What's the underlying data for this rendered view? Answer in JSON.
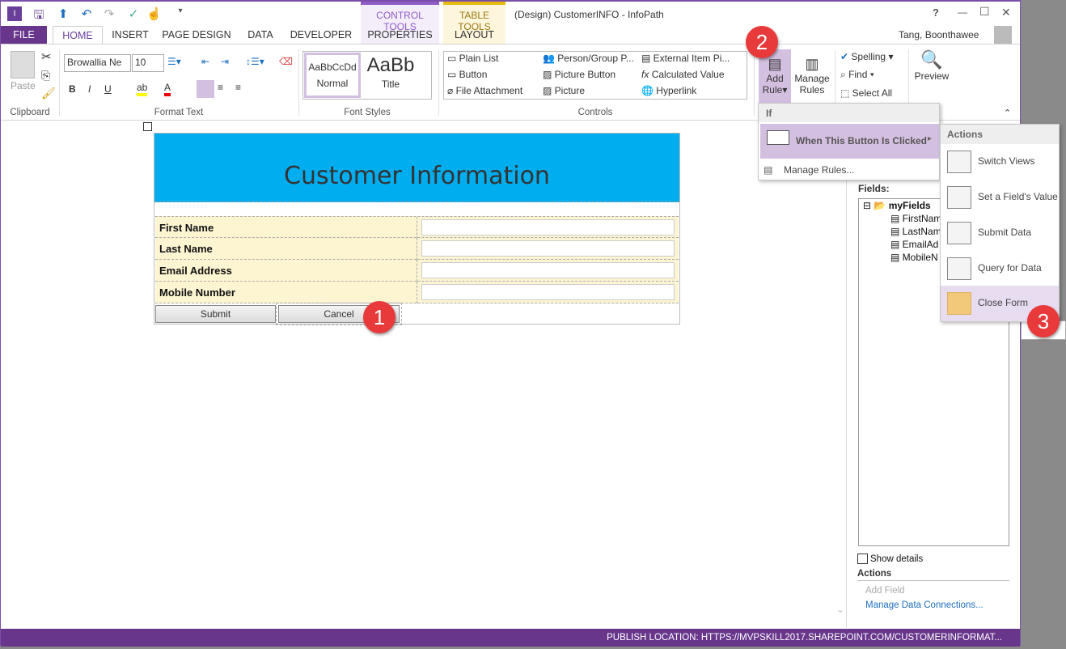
{
  "window": {
    "title": "(Design) CustomerINFO - InfoPath",
    "help": "?",
    "minimize": "—",
    "maximize": "☐",
    "close": "✕",
    "user": "Tang, Boonthawee"
  },
  "context_tabs": {
    "control_tools": "CONTROL TOOLS",
    "table_tools": "TABLE TOOLS"
  },
  "tabs": [
    "FILE",
    "HOME",
    "INSERT",
    "PAGE DESIGN",
    "DATA",
    "DEVELOPER",
    "PROPERTIES",
    "LAYOUT"
  ],
  "ribbon": {
    "clipboard": {
      "paste": "Paste",
      "group": "Clipboard"
    },
    "format_text": {
      "font": "Browallia Ne",
      "size": "10",
      "bold": "B",
      "italic": "I",
      "underline": "U",
      "group": "Format Text"
    },
    "font_styles": {
      "normal_preview": "AaBbCcDd",
      "normal": "Normal",
      "title_preview": "AaBb",
      "title": "Title",
      "group": "Font Styles"
    },
    "controls": {
      "items": [
        "Plain List",
        "Person/Group P...",
        "External Item Pi...",
        "Button",
        "Picture Button",
        "Calculated Value",
        "File Attachment",
        "Picture",
        "Hyperlink"
      ],
      "group": "Controls"
    },
    "add_rule": {
      "line1": "Add",
      "line2": "Rule"
    },
    "manage_rules": {
      "line1": "Manage",
      "line2": "Rules"
    },
    "editing": {
      "spelling": "Spelling",
      "find": "Find",
      "select_all": "Select All"
    },
    "preview": "Preview"
  },
  "add_rule_menu": {
    "header": "If",
    "item": "When This Button Is Clicked",
    "manage": "Manage Rules..."
  },
  "actions_menu": {
    "header": "Actions",
    "items": [
      "Switch Views",
      "Set a Field's Value",
      "Submit Data",
      "Query for Data",
      "Close Form"
    ]
  },
  "form": {
    "title": "Customer Information",
    "header_color": "#00aeef",
    "fields": [
      "First Name",
      "Last Name",
      "Email Address",
      "Mobile Number"
    ],
    "submit": "Submit",
    "cancel": "Cancel"
  },
  "fields_pane": {
    "label": "Fields:",
    "root": "myFields",
    "children": [
      "FirstNam",
      "LastNam",
      "EmailAd",
      "MobileN"
    ],
    "show_details": "Show details",
    "actions_header": "Actions",
    "add_field": "Add Field",
    "manage_connections": "Manage Data Connections..."
  },
  "status": {
    "publish": "PUBLISH LOCATION: HTTPS://MVPSKILL2017.SHAREPOINT.COM/CUSTOMERINFORMAT..."
  },
  "badges": [
    "1",
    "2",
    "3"
  ],
  "colors": {
    "accent": "#68378c",
    "badge": "#e8393b",
    "menu_highlight": "#d3bfe0"
  }
}
